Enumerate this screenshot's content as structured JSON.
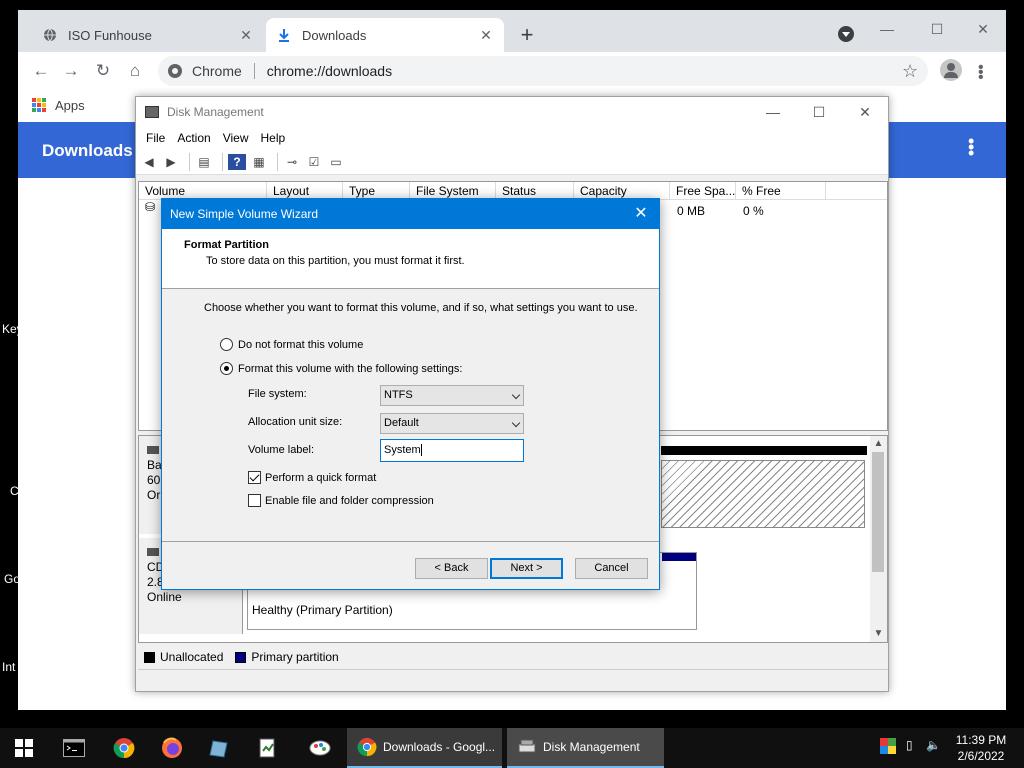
{
  "desktop": {
    "fragments": [
      "Key",
      "C",
      "Go",
      "Int"
    ]
  },
  "browser": {
    "tabs": [
      {
        "title": "ISO Funhouse",
        "active": false
      },
      {
        "title": "Downloads",
        "active": true
      }
    ],
    "omnibox": {
      "site": "Chrome",
      "url": "chrome://downloads"
    },
    "bookmarks": {
      "apps_label": "Apps"
    },
    "page_title": "Downloads"
  },
  "disk_management": {
    "title": "Disk Management",
    "menu": [
      "File",
      "Action",
      "View",
      "Help"
    ],
    "columns": [
      "Volume",
      "Layout",
      "Type",
      "File System",
      "Status",
      "Capacity",
      "Free Spa...",
      "% Free"
    ],
    "row": {
      "volume": "(",
      "free_space": "0 MB",
      "percent_free": "0 %"
    },
    "disk0": {
      "line1": "Ba",
      "line2": "60.",
      "line3": "Or"
    },
    "cd": {
      "line1": "CD",
      "line2": "2.8",
      "line3": "Online",
      "partition_status": "Healthy (Primary Partition)"
    },
    "legend": [
      {
        "label": "Unallocated",
        "color": "#000000"
      },
      {
        "label": "Primary partition",
        "color": "#000080"
      }
    ]
  },
  "wizard": {
    "title": "New Simple Volume Wizard",
    "heading": "Format Partition",
    "subheading": "To store data on this partition, you must format it first.",
    "intro": "Choose whether you want to format this volume, and if so, what settings you want to use.",
    "option_no_format": "Do not format this volume",
    "option_format": "Format this volume with the following settings:",
    "selected_option": "format",
    "file_system_label": "File system:",
    "file_system_value": "NTFS",
    "alloc_label": "Allocation unit size:",
    "alloc_value": "Default",
    "volume_label_label": "Volume label:",
    "volume_label_value": "System",
    "quick_format_label": "Perform a quick format",
    "quick_format_checked": true,
    "compression_label": "Enable file and folder compression",
    "compression_checked": false,
    "back_label": "< Back",
    "next_label": "Next >",
    "cancel_label": "Cancel"
  },
  "taskbar": {
    "chrome_task": "Downloads - Googl...",
    "dm_task": "Disk Management",
    "time": "11:39 PM",
    "date": "2/6/2022"
  },
  "colors": {
    "accent": "#0078d7",
    "chrome_header": "#3367d6"
  }
}
